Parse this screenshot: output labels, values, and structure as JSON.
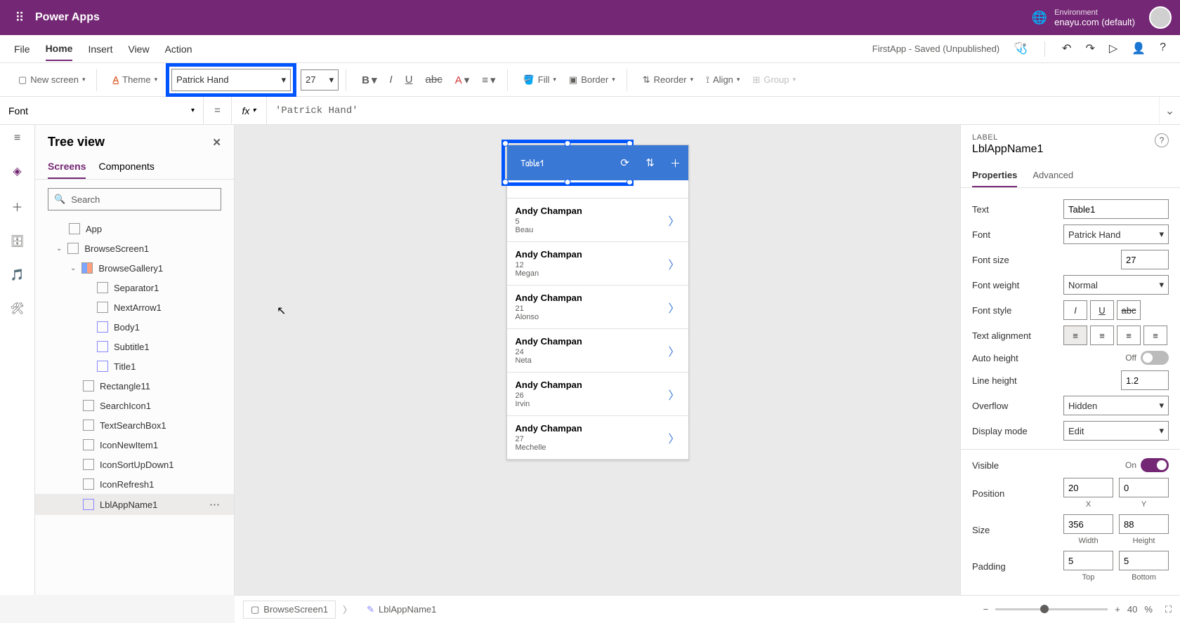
{
  "topbar": {
    "app": "Power Apps",
    "env_label": "Environment",
    "env_value": "enayu.com (default)"
  },
  "menubar": {
    "items": [
      "File",
      "Home",
      "Insert",
      "View",
      "Action"
    ],
    "active": "Home",
    "status": "FirstApp - Saved (Unpublished)"
  },
  "ribbon": {
    "new_screen": "New screen",
    "theme": "Theme",
    "font_value": "Patrick Hand",
    "size_value": "27",
    "fill": "Fill",
    "border": "Border",
    "reorder": "Reorder",
    "align": "Align",
    "group": "Group"
  },
  "formula": {
    "prop": "Font",
    "value": "'Patrick Hand'"
  },
  "tree": {
    "title": "Tree view",
    "tabs": {
      "screens": "Screens",
      "components": "Components"
    },
    "search_placeholder": "Search",
    "items": [
      {
        "indent": 0,
        "label": "App",
        "icon": "app"
      },
      {
        "indent": 0,
        "label": "BrowseScreen1",
        "icon": "screen",
        "expand": true
      },
      {
        "indent": 1,
        "label": "BrowseGallery1",
        "icon": "gallery",
        "expand": true
      },
      {
        "indent": 2,
        "label": "Separator1",
        "icon": "sep"
      },
      {
        "indent": 2,
        "label": "NextArrow1",
        "icon": "na"
      },
      {
        "indent": 2,
        "label": "Body1",
        "icon": "edit"
      },
      {
        "indent": 2,
        "label": "Subtitle1",
        "icon": "edit"
      },
      {
        "indent": 2,
        "label": "Title1",
        "icon": "edit"
      },
      {
        "indent": 1,
        "label": "Rectangle11",
        "icon": "sep"
      },
      {
        "indent": 1,
        "label": "SearchIcon1",
        "icon": "na"
      },
      {
        "indent": 1,
        "label": "TextSearchBox1",
        "icon": "tsb"
      },
      {
        "indent": 1,
        "label": "IconNewItem1",
        "icon": "na"
      },
      {
        "indent": 1,
        "label": "IconSortUpDown1",
        "icon": "na"
      },
      {
        "indent": 1,
        "label": "IconRefresh1",
        "icon": "na"
      },
      {
        "indent": 1,
        "label": "LblAppName1",
        "icon": "edit",
        "selected": true
      }
    ]
  },
  "canvas": {
    "title_text": "Table1",
    "rows": [
      {
        "name": "Andy Champan",
        "sub1": "5",
        "sub2": "Beau"
      },
      {
        "name": "Andy Champan",
        "sub1": "12",
        "sub2": "Megan"
      },
      {
        "name": "Andy Champan",
        "sub1": "21",
        "sub2": "Alonso"
      },
      {
        "name": "Andy Champan",
        "sub1": "24",
        "sub2": "Neta"
      },
      {
        "name": "Andy Champan",
        "sub1": "26",
        "sub2": "Irvin"
      },
      {
        "name": "Andy Champan",
        "sub1": "27",
        "sub2": "Mechelle"
      }
    ]
  },
  "props": {
    "type": "LABEL",
    "name": "LblAppName1",
    "tabs": {
      "p": "Properties",
      "a": "Advanced"
    },
    "text_lbl": "Text",
    "text_val": "Table1",
    "font_lbl": "Font",
    "font_val": "Patrick Hand",
    "size_lbl": "Font size",
    "size_val": "27",
    "weight_lbl": "Font weight",
    "weight_val": "Normal",
    "style_lbl": "Font style",
    "align_lbl": "Text alignment",
    "autoh_lbl": "Auto height",
    "autoh_state": "Off",
    "lineh_lbl": "Line height",
    "lineh_val": "1.2",
    "overflow_lbl": "Overflow",
    "overflow_val": "Hidden",
    "display_lbl": "Display mode",
    "display_val": "Edit",
    "visible_lbl": "Visible",
    "visible_state": "On",
    "pos_lbl": "Position",
    "pos_x": "20",
    "pos_y": "0",
    "x_lbl": "X",
    "y_lbl": "Y",
    "size2_lbl": "Size",
    "w_val": "356",
    "h_val": "88",
    "w_lbl": "Width",
    "h_lbl": "Height",
    "pad_lbl": "Padding",
    "pad_t": "5",
    "pad_b": "5",
    "t_lbl": "Top",
    "b_lbl": "Bottom"
  },
  "status": {
    "screen": "BrowseScreen1",
    "sel": "LblAppName1",
    "zoom": "40",
    "pct": "%"
  }
}
